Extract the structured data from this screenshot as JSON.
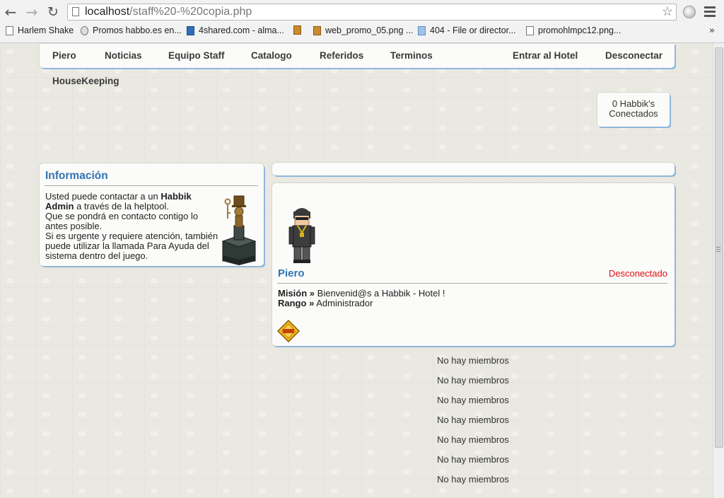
{
  "browser": {
    "url_host": "localhost",
    "url_path": "/staff%20-%20copia.php",
    "bookmarks": [
      {
        "label": "Harlem Shake",
        "icon": "page-icon"
      },
      {
        "label": "Promos habbo.es en...",
        "icon": "badge-icon"
      },
      {
        "label": "4shared.com - alma...",
        "icon": "4shared-icon"
      },
      {
        "label": "",
        "icon": "package-icon"
      },
      {
        "label": "web_promo_05.png ...",
        "icon": "package-icon"
      },
      {
        "label": "404 - File or director...",
        "icon": "network-icon"
      },
      {
        "label": "promohlmpc12.png...",
        "icon": "page-icon"
      }
    ],
    "more_label": "»"
  },
  "nav": {
    "items": [
      "Piero",
      "Noticias",
      "Equipo Staff",
      "Catalogo",
      "Referidos",
      "Terminos",
      "Entrar al Hotel",
      "Desconectar"
    ],
    "housekeeping": "HouseKeeping"
  },
  "online": {
    "line1": "0 Habbik's",
    "line2": "Conectados"
  },
  "info": {
    "title": "Información",
    "t1": "Usted puede contactar a un ",
    "t1_bold": "Habbik Admin",
    "t1_rest": " a través de la helptool.",
    "t2": "Que se pondrá en contacto contigo lo antes posible.",
    "t3": "Si es urgente y requiere atención, también puede utilizar la llamada Para Ayuda del sistema dentro del juego."
  },
  "profile": {
    "name": "Piero",
    "status": "Desconectado",
    "mission_label": "Misión",
    "mission_value": "Bienvenid@s a Habbik - Hotel !",
    "rank_label": "Rango",
    "rank_value": "Administrador",
    "separator": "»"
  },
  "members": {
    "empty_items": [
      "No hay miembros",
      "No hay miembros",
      "No hay miembros",
      "No hay miembros",
      "No hay miembros",
      "No hay miembros",
      "No hay miembros"
    ]
  },
  "colors": {
    "accent_blue": "#2f73b3",
    "status_red": "#e01010",
    "page_bg": "#e9e8e1"
  }
}
